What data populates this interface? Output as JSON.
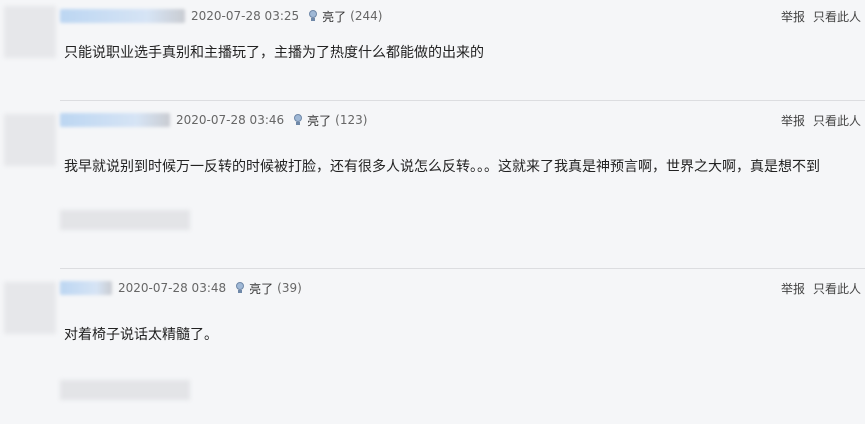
{
  "comments": [
    {
      "time": "2020-07-28 03:25",
      "light_label": "亮了",
      "light_count": "(244)",
      "report": "举报",
      "only_this": "只看此人",
      "content": "只能说职业选手真别和主播玩了，主播为了热度什么都能做的出来的"
    },
    {
      "time": "2020-07-28 03:46",
      "light_label": "亮了",
      "light_count": "(123)",
      "report": "举报",
      "only_this": "只看此人",
      "content": "我早就说别到时候万一反转的时候被打脸，还有很多人说怎么反转。。。这就来了我真是神预言啊，世界之大啊，真是想不到"
    },
    {
      "time": "2020-07-28 03:48",
      "light_label": "亮了",
      "light_count": "(39)",
      "report": "举报",
      "only_this": "只看此人",
      "content": "对着椅子说话太精髓了。"
    }
  ]
}
